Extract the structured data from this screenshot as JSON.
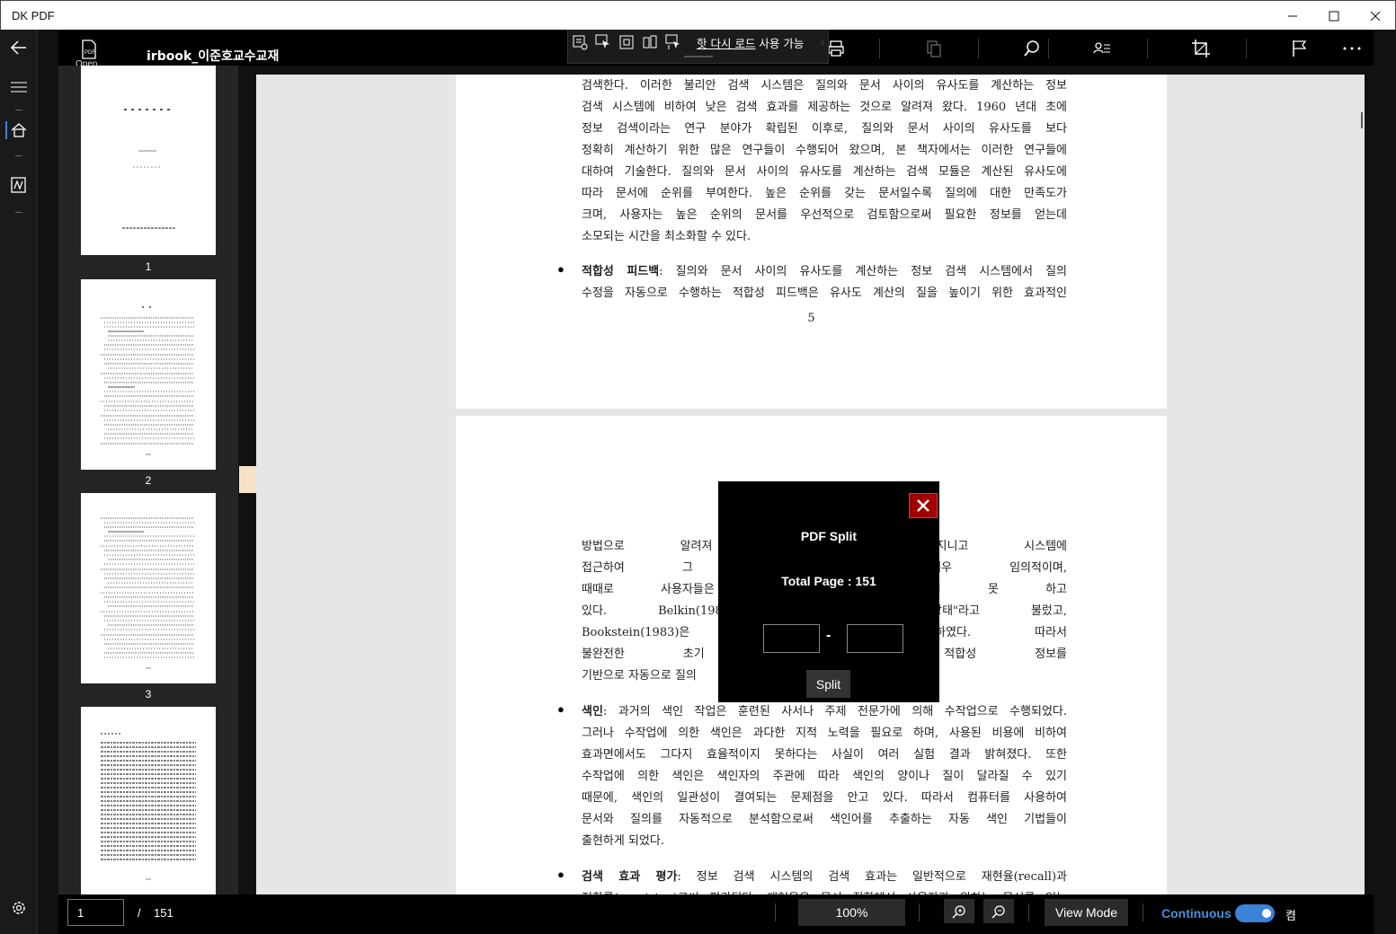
{
  "window": {
    "title": "DK PDF"
  },
  "topbar": {
    "open_label": "Open",
    "doc_title": "irbook_이준호교수교재"
  },
  "hot_reload": {
    "text_link": "핫 다시 로드",
    "text_rest": " 사용 가능"
  },
  "thumbnails": [
    {
      "num": "1"
    },
    {
      "num": "2"
    },
    {
      "num": "3"
    },
    {
      "num": ""
    }
  ],
  "page_top": {
    "lines": [
      "검색한다. 이러한 불리안 검색 시스템은 질의와 문서 사이의 유사도를 계산하는 정보",
      "검색 시스템에 비하여 낮은 검색 효과를 제공하는 것으로 알려져 왔다. 1960 년대 초에",
      "정보 검색이라는 연구 분야가 확립된 이후로, 질의와 문서 사이의 유사도를 보다",
      "정확히 계산하기 위한 많은 연구들이 수행되어 왔으며, 본 책자에서는 이러한 연구들에",
      "대하여 기술한다. 질의와 문서 사이의 유사도를 계산하는 검색 모듈은 계산된 유사도에",
      "따라 문서에 순위를 부여한다. 높은 순위를 갖는 문서일수록 질의에 대한 만족도가",
      "크며, 사용자는 높은 순위의 문서를 우선적으로 검토함으로써 필요한 정보를 얻는데",
      "소모되는 시간을 최소화할 수 있다."
    ],
    "bullet_term": "적합성 피드백",
    "bullet_lines": [
      ": 질의와 문서 사이의 유사도를 계산하는 정보 검색 시스템에서 질의",
      "수정을 자동으로 수행하는 적합성 피드백은 유사도 계산의 질을 높이기 위한 효과적인"
    ],
    "page_number": "5"
  },
  "page_bottom": {
    "lines": [
      "방법으로 알려져 왔다.                              요구를 지니고 시스템에",
      "접근하여 그 요구들을                               의는 매우 임의적이며,",
      "때때로 사용자들은 그들                             차도 파악하지 못 하고",
      "있다. Belkin(1982)은 시                            식의 상태\"라고 불렀고,",
      "Bookstein(1983)은 불확                             라고 말하였다. 따라서",
      "불완전한 초기 질의는                               용자의 적합성 정보를",
      "기반으로 자동으로 질의"
    ],
    "bullet2_term": "색인",
    "bullet2_lines": [
      ": 과거의 색인 작업은 훈련된 사서나 주제 전문가에 의해 수작업으로 수행되었다.",
      "그러나 수작업에 의한 색인은 과다한 지적 노력을 필요로 하며, 사용된 비용에 비하여",
      "효과면에서도 그다지 효율적이지 못하다는 사실이 여러 실험 결과 밝혀졌다. 또한",
      "수작업에 의한 색인은 색인자의 주관에 따라 색인의 양이나 질이 달라질 수 있기",
      "때문에, 색인의 일관성이 결여되는 문제점을 안고 있다. 따라서 컴퓨터를 사용하여",
      "문서와 질의를 자동적으로 분석함으로써 색인어를 추출하는 자동 색인 기법들이",
      "출현하게 되었다."
    ],
    "bullet3_term": "검색 효과 평가",
    "bullet3_lines": [
      ": 정보 검색 시스템의 검색 효과는 일반적으로 재현율(recall)과",
      "정확률(precision)로써 평가된다. 재현율은 문서 집합에서 사용자가 원하는 문서를 얻는"
    ]
  },
  "modal": {
    "title": "PDF Split",
    "total": "Total Page : 151",
    "from_value": "",
    "to_value": "",
    "dash": "-",
    "split_label": "Split"
  },
  "bottombar": {
    "page_value": "1",
    "page_total": "/    151",
    "zoom": "100%",
    "view_mode": "View Mode",
    "continuous_label": "Continuous",
    "toggle_state": "켬"
  },
  "colors": {
    "accent": "#3b82d9",
    "close_red": "#a00000"
  }
}
